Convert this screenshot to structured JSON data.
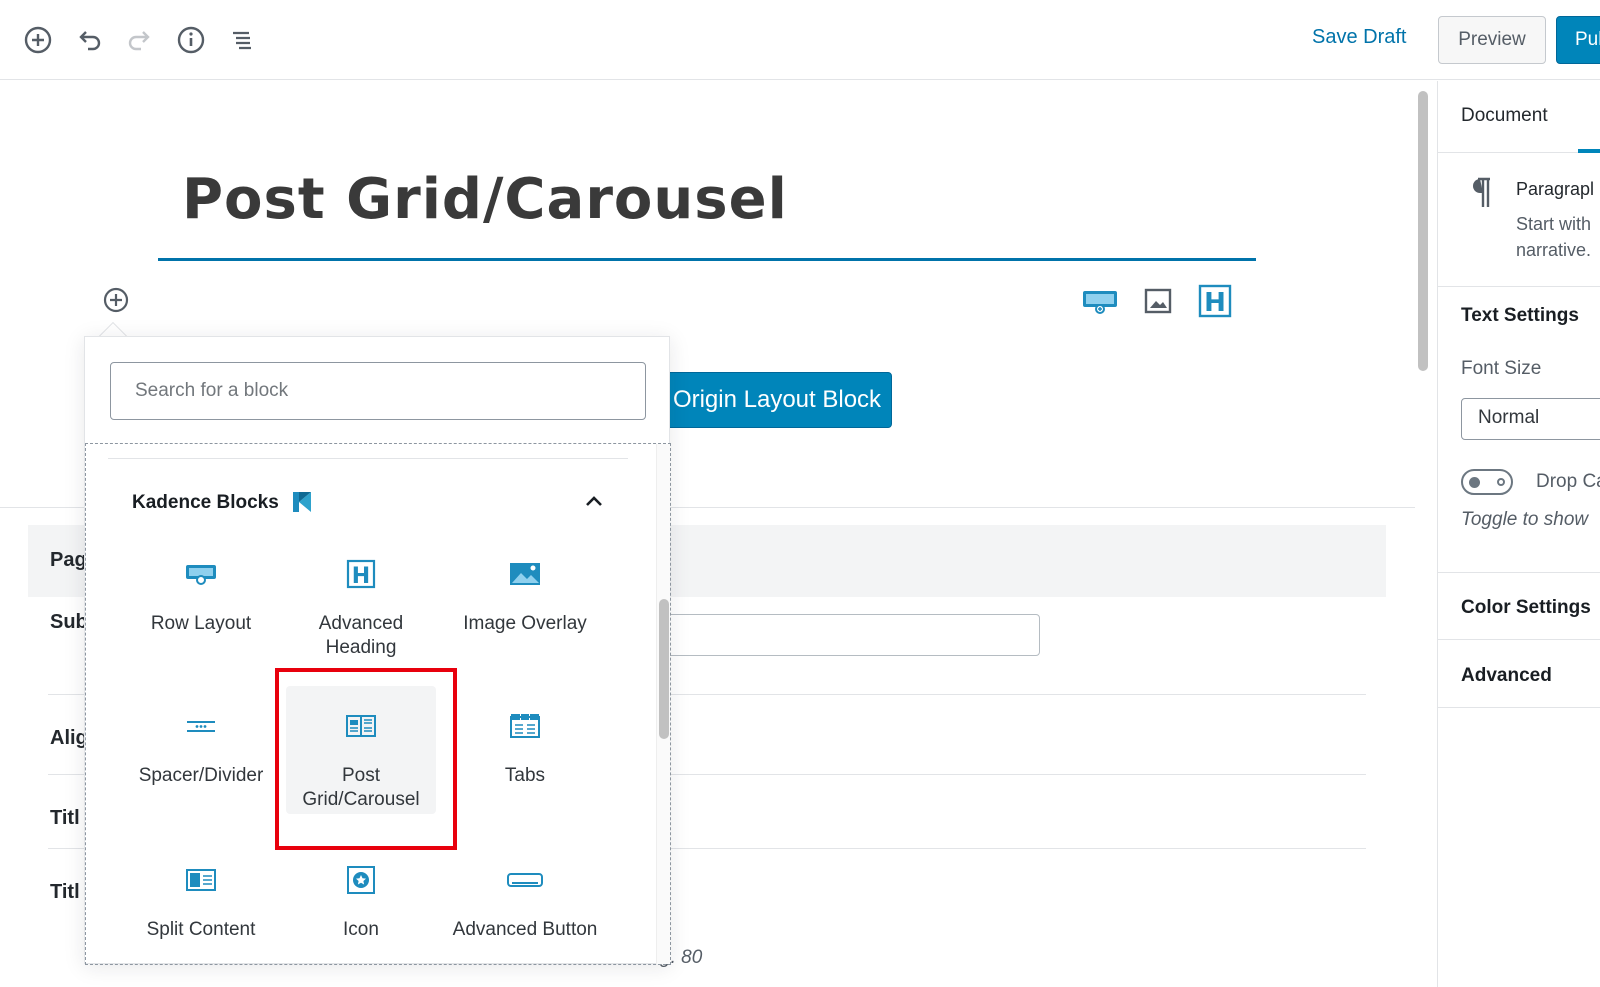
{
  "toolbar": {
    "icons": [
      "add-block-icon",
      "undo-icon",
      "redo-icon",
      "info-icon",
      "block-navigation-icon"
    ],
    "save_draft": "Save Draft",
    "preview": "Preview",
    "publish": "Pul"
  },
  "editor": {
    "post_title": "Post Grid/Carousel",
    "origin_button": "Origin Layout Block",
    "meta_header_label": "Pag",
    "meta_rows": [
      "Sub",
      "Alig",
      "Titl",
      "Titl"
    ],
    "meta_hint": "g. 80"
  },
  "sidebar": {
    "tab_document": "Document",
    "block_title": "Paragrapl",
    "block_desc": "Start with narrative.",
    "text_settings": "Text Settings",
    "font_size_label": "Font Size",
    "font_size_value": "Normal",
    "drop_cap_label": "Drop Ca",
    "drop_cap_help": "Toggle to show",
    "color_settings": "Color Settings",
    "advanced": "Advanced"
  },
  "inserter": {
    "search_placeholder": "Search for a block",
    "panel_title": "Kadence Blocks",
    "blocks": [
      {
        "label": "Row Layout",
        "icon": "row-layout-icon"
      },
      {
        "label": "Advanced Heading",
        "icon": "advanced-heading-icon"
      },
      {
        "label": "Image Overlay",
        "icon": "image-overlay-icon"
      },
      {
        "label": "Spacer/Divider",
        "icon": "spacer-divider-icon"
      },
      {
        "label": "Post Grid/Carousel",
        "icon": "post-grid-icon"
      },
      {
        "label": "Tabs",
        "icon": "tabs-icon"
      },
      {
        "label": "Split Content",
        "icon": "split-content-icon"
      },
      {
        "label": "Icon",
        "icon": "icon-block-icon"
      },
      {
        "label": "Advanced Button",
        "icon": "advanced-button-icon"
      }
    ]
  },
  "colors": {
    "accent": "#0085ba",
    "link": "#0073aa",
    "icon_blue": "#1e8cbe",
    "highlight": "#e8000d"
  }
}
